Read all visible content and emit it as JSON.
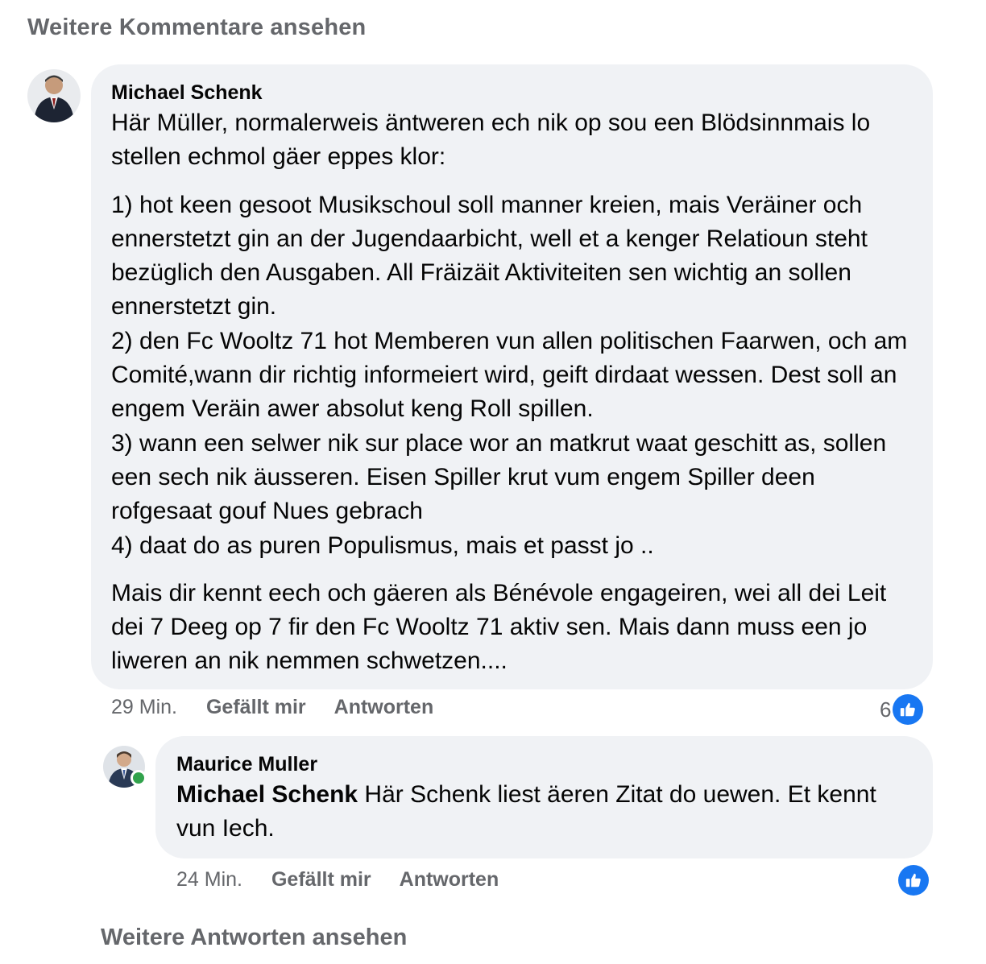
{
  "view_more_comments": "Weitere Kommentare ansehen",
  "comment": {
    "author": "Michael Schenk",
    "avatar_icon": "profile-photo-michael-schenk",
    "paragraphs": [
      "Här Müller, normalerweis äntweren ech nik op sou een Blödsinnmais lo stellen echmol gäer eppes klor:",
      "1) hot keen gesoot Musikschoul soll manner kreien, mais Veräiner och ennerstetzt gin an der Jugendaarbicht, well et a kenger Relatioun steht bezüglich den Ausgaben. All Fräizäit Aktiviteiten sen wichtig an sollen ennerstetzt gin.",
      "2) den Fc Wooltz 71 hot Memberen vun allen politischen Faarwen, och am Comité,wann dir richtig informeiert wird, geift dirdaat wessen. Dest soll an engem Veräin awer absolut keng Roll spillen.",
      "3) wann een selwer nik sur place wor an matkrut waat geschitt as, sollen een sech nik äusseren. Eisen Spiller krut vum engem Spiller deen rofgesaat gouf Nues gebrach",
      "4) daat do as puren Populismus, mais et passt jo ..",
      "Mais dir kennt eech och gäeren als Bénévole engageiren, wei all dei Leit dei 7 Deeg op 7 fir den Fc Wooltz 71 aktiv sen. Mais dann muss een jo liweren an nik nemmen schwetzen...."
    ],
    "time": "29 Min.",
    "like_label": "Gefällt mir",
    "reply_label": "Antworten",
    "reaction_count": "6",
    "reaction_icon": "like-thumb-icon",
    "accent_color": "#1877f2"
  },
  "reply": {
    "author": "Maurice Muller",
    "avatar_icon": "profile-photo-maurice-muller",
    "online": true,
    "mention": "Michael Schenk",
    "text": " Här Schenk liest äeren Zitat do uewen. Et kennt vun Iech.",
    "time": "24 Min.",
    "like_label": "Gefällt mir",
    "reply_label": "Antworten",
    "reaction_icon": "like-thumb-icon"
  },
  "view_more_replies": "Weitere Antworten ansehen"
}
